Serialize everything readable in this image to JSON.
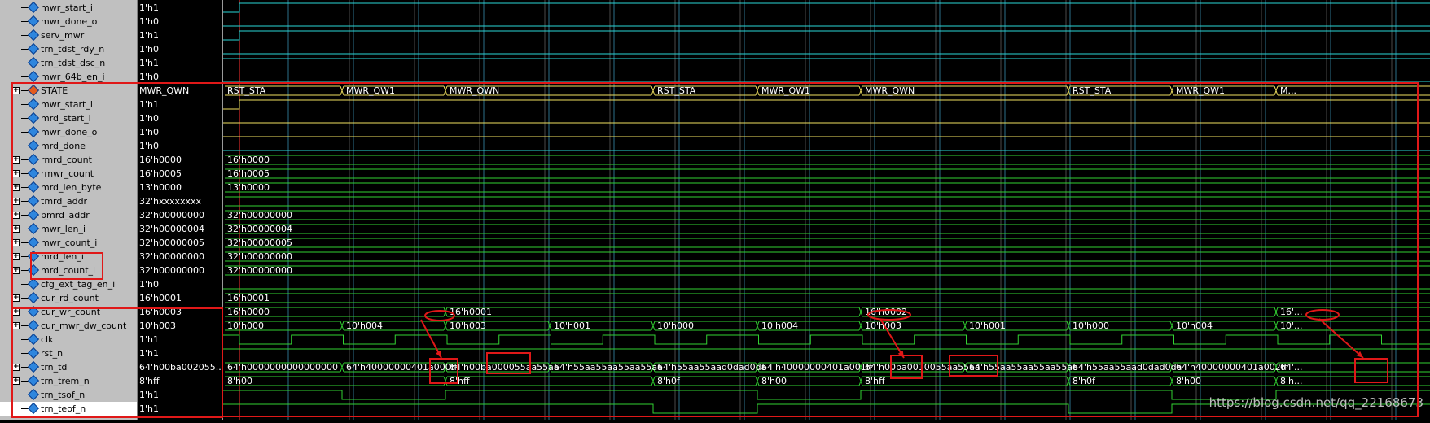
{
  "signals": [
    {
      "name": "mwr_start_i",
      "value": "1'h1",
      "expand": false,
      "icon_color": "#2e86de"
    },
    {
      "name": "mwr_done_o",
      "value": "1'h0",
      "expand": false,
      "icon_color": "#2e86de"
    },
    {
      "name": "serv_mwr",
      "value": "1'h1",
      "expand": false,
      "icon_color": "#2e86de"
    },
    {
      "name": "trn_tdst_rdy_n",
      "value": "1'h0",
      "expand": false,
      "icon_color": "#2e86de"
    },
    {
      "name": "trn_tdst_dsc_n",
      "value": "1'h1",
      "expand": false,
      "icon_color": "#2e86de"
    },
    {
      "name": "mwr_64b_en_i",
      "value": "1'h0",
      "expand": false,
      "icon_color": "#2e86de"
    },
    {
      "name": "STATE",
      "value": "MWR_QWN",
      "expand": true,
      "icon_color": "#e35b1e"
    },
    {
      "name": "mwr_start_i",
      "value": "1'h1",
      "expand": false,
      "icon_color": "#2e86de"
    },
    {
      "name": "mrd_start_i",
      "value": "1'h0",
      "expand": false,
      "icon_color": "#2e86de"
    },
    {
      "name": "mwr_done_o",
      "value": "1'h0",
      "expand": false,
      "icon_color": "#2e86de"
    },
    {
      "name": "mrd_done",
      "value": "1'h0",
      "expand": false,
      "icon_color": "#2e86de"
    },
    {
      "name": "rmrd_count",
      "value": "16'h0000",
      "expand": true,
      "icon_color": "#2e86de"
    },
    {
      "name": "rmwr_count",
      "value": "16'h0005",
      "expand": true,
      "icon_color": "#2e86de"
    },
    {
      "name": "mrd_len_byte",
      "value": "13'h0000",
      "expand": true,
      "icon_color": "#2e86de"
    },
    {
      "name": "tmrd_addr",
      "value": "32'hxxxxxxxx",
      "expand": true,
      "icon_color": "#2e86de"
    },
    {
      "name": "pmrd_addr",
      "value": "32'h00000000",
      "expand": true,
      "icon_color": "#2e86de"
    },
    {
      "name": "mwr_len_i",
      "value": "32'h00000004",
      "expand": true,
      "icon_color": "#2e86de"
    },
    {
      "name": "mwr_count_i",
      "value": "32'h00000005",
      "expand": true,
      "icon_color": "#2e86de"
    },
    {
      "name": "mrd_len_i",
      "value": "32'h00000000",
      "expand": true,
      "icon_color": "#2e86de"
    },
    {
      "name": "mrd_count_i",
      "value": "32'h00000000",
      "expand": true,
      "icon_color": "#2e86de"
    },
    {
      "name": "cfg_ext_tag_en_i",
      "value": "1'h0",
      "expand": false,
      "icon_color": "#2e86de"
    },
    {
      "name": "cur_rd_count",
      "value": "16'h0001",
      "expand": true,
      "icon_color": "#2e86de"
    },
    {
      "name": "cur_wr_count",
      "value": "16'h0003",
      "expand": true,
      "icon_color": "#2e86de"
    },
    {
      "name": "cur_mwr_dw_count",
      "value": "10'h003",
      "expand": true,
      "icon_color": "#2e86de"
    },
    {
      "name": "clk",
      "value": "1'h1",
      "expand": false,
      "icon_color": "#2e86de"
    },
    {
      "name": "rst_n",
      "value": "1'h1",
      "expand": false,
      "icon_color": "#2e86de"
    },
    {
      "name": "trn_td",
      "value": "64'h00ba002055...",
      "expand": true,
      "icon_color": "#2e86de"
    },
    {
      "name": "trn_trem_n",
      "value": "8'hff",
      "expand": true,
      "icon_color": "#2e86de"
    },
    {
      "name": "trn_tsof_n",
      "value": "1'h1",
      "expand": false,
      "icon_color": "#2e86de"
    },
    {
      "name": "trn_teof_n",
      "value": "1'h1",
      "expand": false,
      "icon_color": "#2e86de",
      "highlight": true
    }
  ],
  "bus_labels": [
    {
      "row": 6,
      "segments": [
        [
          0,
          "RST_STA"
        ],
        [
          146,
          "MWR_QW1"
        ],
        [
          273,
          "MWR_QWN"
        ],
        [
          528,
          "RST_STA"
        ],
        [
          656,
          "MWR_QW1"
        ],
        [
          783,
          "MWR_QWN"
        ],
        [
          1038,
          "RST_STA"
        ],
        [
          1165,
          "MWR_QW1"
        ],
        [
          1293,
          "M..."
        ]
      ]
    },
    {
      "row": 11,
      "segments": [
        [
          0,
          "16'h0000"
        ]
      ]
    },
    {
      "row": 12,
      "segments": [
        [
          0,
          "16'h0005"
        ]
      ]
    },
    {
      "row": 13,
      "segments": [
        [
          0,
          "13'h0000"
        ]
      ]
    },
    {
      "row": 14,
      "segments": [
        [
          0,
          ""
        ]
      ]
    },
    {
      "row": 15,
      "segments": [
        [
          0,
          "32'h00000000"
        ]
      ]
    },
    {
      "row": 16,
      "segments": [
        [
          0,
          "32'h00000004"
        ]
      ]
    },
    {
      "row": 17,
      "segments": [
        [
          0,
          "32'h00000005"
        ]
      ]
    },
    {
      "row": 18,
      "segments": [
        [
          0,
          "32'h00000000"
        ]
      ]
    },
    {
      "row": 19,
      "segments": [
        [
          0,
          "32'h00000000"
        ]
      ]
    },
    {
      "row": 21,
      "segments": [
        [
          0,
          "16'h0001"
        ]
      ]
    },
    {
      "row": 22,
      "segments": [
        [
          0,
          "16'h0000"
        ],
        [
          273,
          "16'h0001"
        ],
        [
          783,
          "16'h0002"
        ],
        [
          1293,
          "16'..."
        ]
      ]
    },
    {
      "row": 23,
      "segments": [
        [
          0,
          "10'h000"
        ],
        [
          146,
          "10'h004"
        ],
        [
          273,
          "10'h003"
        ],
        [
          401,
          "10'h001"
        ],
        [
          528,
          "10'h000"
        ],
        [
          656,
          "10'h004"
        ],
        [
          783,
          "10'h003"
        ],
        [
          911,
          "10'h001"
        ],
        [
          1038,
          "10'h000"
        ],
        [
          1165,
          "10'h004"
        ],
        [
          1293,
          "10'..."
        ]
      ]
    },
    {
      "row": 26,
      "segments": [
        [
          0,
          "64'h0000000000000000"
        ],
        [
          146,
          "64'h40000000401a000ff"
        ],
        [
          273,
          "64'h00ba000055aa55aa"
        ],
        [
          401,
          "64'h55aa55aa55aa55aa"
        ],
        [
          528,
          "64'h55aa55aad0dad0da"
        ],
        [
          656,
          "64'h40000000401a001ff"
        ],
        [
          783,
          "64'h00ba0010055aa55aa"
        ],
        [
          911,
          "64'h55aa55aa55aa55aa"
        ],
        [
          1038,
          "64'h55aa55aad0dad0da"
        ],
        [
          1165,
          "64'h40000000401a002ff"
        ],
        [
          1293,
          "64'..."
        ]
      ]
    },
    {
      "row": 27,
      "segments": [
        [
          0,
          "8'h00"
        ],
        [
          273,
          "8'hff"
        ],
        [
          528,
          "8'h0f"
        ],
        [
          656,
          "8'h00"
        ],
        [
          783,
          "8'hff"
        ],
        [
          1038,
          "8'h0f"
        ],
        [
          1165,
          "8'h00"
        ],
        [
          1293,
          "8'h..."
        ]
      ]
    }
  ],
  "watermark": "https://blog.csdn.net/qq_22168673"
}
